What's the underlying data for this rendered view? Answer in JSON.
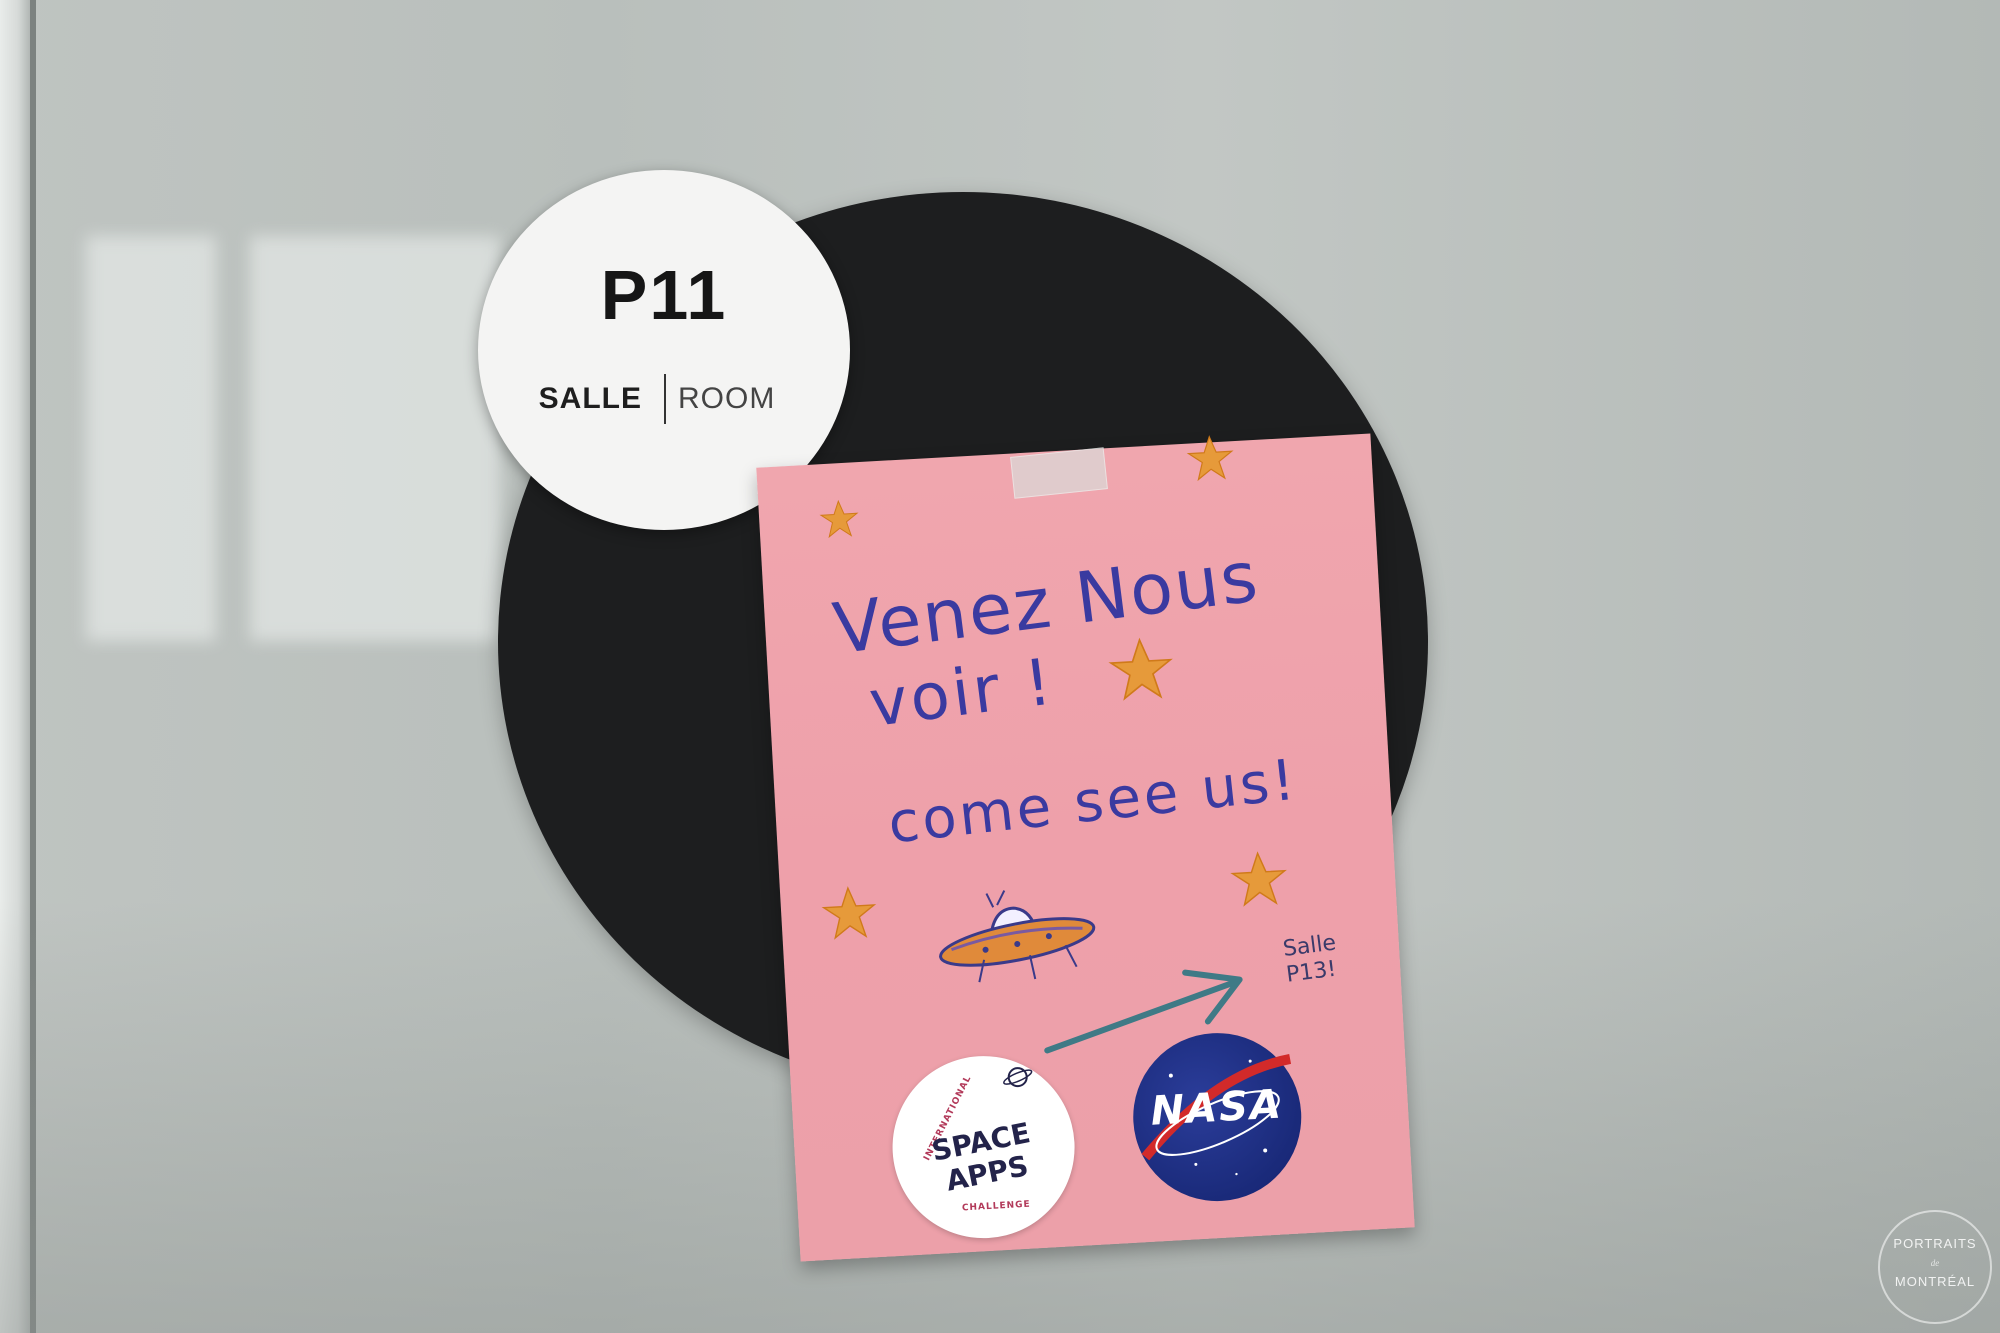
{
  "room_sign": {
    "number": "P11",
    "label_fr": "SALLE",
    "label_en": "ROOM"
  },
  "note": {
    "line1": "Venez Nous",
    "line2": "voir !",
    "line3": "come see us!",
    "direction": [
      "Salle",
      "P13!"
    ],
    "ink_color": "#3a3aa0",
    "paper_color": "#efa3ac",
    "star_color": "#e69a3a"
  },
  "stickers": {
    "space_apps": {
      "top_text": "INTERNATIONAL",
      "main_text": [
        "SPACE APPS"
      ],
      "bottom_text": "CHALLENGE"
    },
    "nasa": {
      "text": "NASA"
    }
  },
  "watermark": {
    "top": "PORTRAITS",
    "middle": "de",
    "bottom": "MONTRÉAL"
  }
}
